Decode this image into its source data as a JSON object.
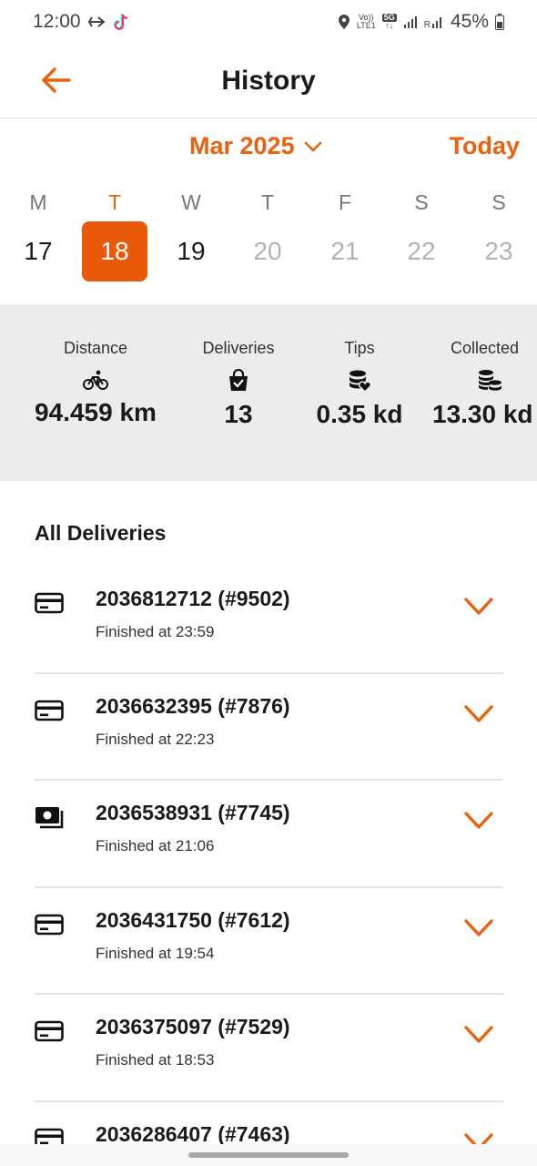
{
  "status_bar": {
    "time": "12:00",
    "network_top": "Vo))",
    "network_bottom": "LTE1",
    "network_gen": "5G",
    "signal_r": "R",
    "battery": "45%",
    "icons": [
      "direction-arrow-icon",
      "tiktok-icon",
      "location-icon",
      "volte-icon",
      "5g-icon",
      "signal-icon",
      "roaming-signal-icon",
      "battery-icon"
    ]
  },
  "header": {
    "title": "History",
    "back_icon": "arrow-left-icon"
  },
  "calendar": {
    "month": "Mar 2025",
    "today_label": "Today",
    "weekdays": [
      "M",
      "T",
      "W",
      "T",
      "F",
      "S",
      "S"
    ],
    "dates": [
      "17",
      "18",
      "19",
      "20",
      "21",
      "22",
      "23"
    ],
    "selected_index": 1
  },
  "stats": [
    {
      "label": "Distance",
      "icon": "bicycle-icon",
      "value": "94.459 km"
    },
    {
      "label": "Deliveries",
      "icon": "shopping-bag-check-icon",
      "value": "13"
    },
    {
      "label": "Tips",
      "icon": "coins-heart-icon",
      "value": "0.35 kd"
    },
    {
      "label": "Collected",
      "icon": "coins-stack-icon",
      "value": "13.30 kd"
    }
  ],
  "deliveries": {
    "title": "All Deliveries",
    "items": [
      {
        "order": "2036812712 (#9502)",
        "finished": "Finished at 23:59",
        "payment": "card-icon"
      },
      {
        "order": "2036632395 (#7876)",
        "finished": "Finished at 22:23",
        "payment": "card-icon"
      },
      {
        "order": "2036538931 (#7745)",
        "finished": "Finished at 21:06",
        "payment": "cash-icon"
      },
      {
        "order": "2036431750 (#7612)",
        "finished": "Finished at 19:54",
        "payment": "card-icon"
      },
      {
        "order": "2036375097 (#7529)",
        "finished": "Finished at 18:53",
        "payment": "card-icon"
      },
      {
        "order": "2036286407 (#7463)",
        "finished": "",
        "payment": "card-icon"
      }
    ]
  },
  "colors": {
    "accent": "#e8620f",
    "selected_bg": "#e85a09",
    "stats_bg": "#ececec"
  }
}
